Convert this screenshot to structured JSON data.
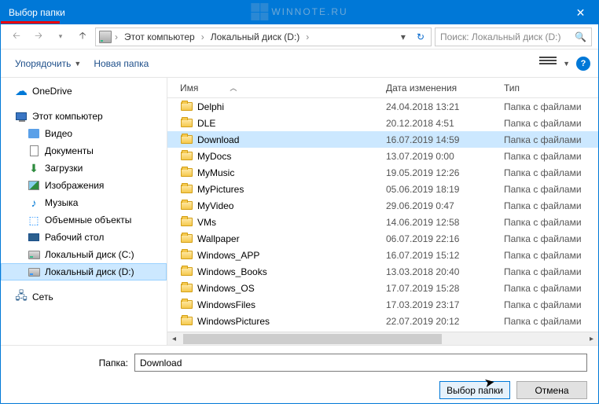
{
  "window": {
    "title": "Выбор папки"
  },
  "watermark": "WINNOTE.RU",
  "nav": {
    "crumbs": [
      "Этот компьютер",
      "Локальный диск (D:)"
    ]
  },
  "search": {
    "placeholder": "Поиск: Локальный диск (D:)"
  },
  "toolbar": {
    "organize": "Упорядочить",
    "new_folder": "Новая папка"
  },
  "sidebar": {
    "onedrive": "OneDrive",
    "this_pc": "Этот компьютер",
    "items": [
      {
        "label": "Видео"
      },
      {
        "label": "Документы"
      },
      {
        "label": "Загрузки"
      },
      {
        "label": "Изображения"
      },
      {
        "label": "Музыка"
      },
      {
        "label": "Объемные объекты"
      },
      {
        "label": "Рабочий стол"
      },
      {
        "label": "Локальный диск (C:)"
      },
      {
        "label": "Локальный диск (D:)"
      }
    ],
    "network": "Сеть"
  },
  "columns": {
    "name": "Имя",
    "date": "Дата изменения",
    "type": "Тип"
  },
  "type_folder": "Папка с файлами",
  "files": [
    {
      "name": "Delphi",
      "date": "24.04.2018 13:21"
    },
    {
      "name": "DLE",
      "date": "20.12.2018 4:51"
    },
    {
      "name": "Download",
      "date": "16.07.2019 14:59",
      "selected": true
    },
    {
      "name": "MyDocs",
      "date": "13.07.2019 0:00"
    },
    {
      "name": "MyMusic",
      "date": "19.05.2019 12:26"
    },
    {
      "name": "MyPictures",
      "date": "05.06.2019 18:19"
    },
    {
      "name": "MyVideo",
      "date": "29.06.2019 0:47"
    },
    {
      "name": "VMs",
      "date": "14.06.2019 12:58"
    },
    {
      "name": "Wallpaper",
      "date": "06.07.2019 22:16"
    },
    {
      "name": "Windows_APP",
      "date": "16.07.2019 15:12"
    },
    {
      "name": "Windows_Books",
      "date": "13.03.2018 20:40"
    },
    {
      "name": "Windows_OS",
      "date": "17.07.2019 15:28"
    },
    {
      "name": "WindowsFiles",
      "date": "17.03.2019 23:17"
    },
    {
      "name": "WindowsPictures",
      "date": "22.07.2019 20:12"
    }
  ],
  "footer": {
    "folder_label": "Папка:",
    "folder_value": "Download",
    "select_btn": "Выбор папки",
    "cancel_btn": "Отмена"
  }
}
